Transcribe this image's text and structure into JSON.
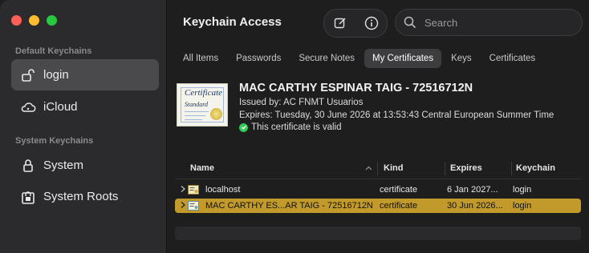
{
  "sidebar": {
    "default_section": "Default Keychains",
    "system_section": "System Keychains",
    "items": [
      {
        "label": "login",
        "icon": "unlocked-padlock-icon"
      },
      {
        "label": "iCloud",
        "icon": "cloud-icon"
      },
      {
        "label": "System",
        "icon": "padlock-icon"
      },
      {
        "label": "System Roots",
        "icon": "lock-cabinet-icon"
      }
    ]
  },
  "header": {
    "title": "Keychain Access",
    "search_placeholder": "Search"
  },
  "tabs": [
    "All Items",
    "Passwords",
    "Secure Notes",
    "My Certificates",
    "Keys",
    "Certificates"
  ],
  "active_tab": "My Certificates",
  "cert": {
    "image_title": "Certificate",
    "image_subtitle": "Standard",
    "name": "MAC CARTHY ESPINAR TAIG - 72516712N",
    "issued_by": "Issued by: AC FNMT Usuarios",
    "expires": "Expires: Tuesday, 30 June 2026 at 13:53:43 Central European Summer Time",
    "valid": "This certificate is valid"
  },
  "table": {
    "columns": [
      "Name",
      "Kind",
      "Expires",
      "Keychain"
    ],
    "rows": [
      {
        "name": "localhost",
        "kind": "certificate",
        "expires": "6 Jan 2027...",
        "keychain": "login"
      },
      {
        "name": "MAC CARTHY ES...AR TAIG - 72516712N",
        "kind": "certificate",
        "expires": "30 Jun 2026...",
        "keychain": "login"
      }
    ]
  },
  "colors": {
    "accent_selection": "#c19a2b",
    "valid_green": "#34c759"
  }
}
